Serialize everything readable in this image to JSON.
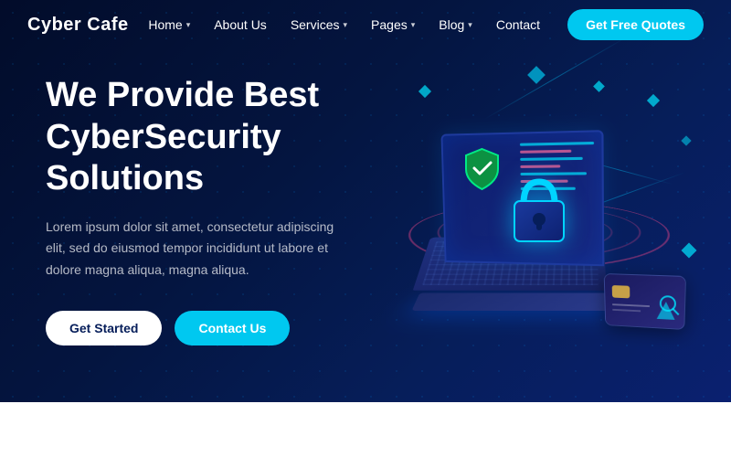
{
  "brand": {
    "name": "Cyber Cafe"
  },
  "nav": {
    "links": [
      {
        "id": "home",
        "label": "Home",
        "hasDropdown": true
      },
      {
        "id": "about",
        "label": "About Us",
        "hasDropdown": false
      },
      {
        "id": "services",
        "label": "Services",
        "hasDropdown": true
      },
      {
        "id": "pages",
        "label": "Pages",
        "hasDropdown": true
      },
      {
        "id": "blog",
        "label": "Blog",
        "hasDropdown": true
      },
      {
        "id": "contact",
        "label": "Contact",
        "hasDropdown": false
      }
    ],
    "cta_label": "Get Free Quotes"
  },
  "hero": {
    "title_line1": "We Provide Best",
    "title_line2": "CyberSecurity Solutions",
    "description": "Lorem ipsum dolor sit amet, consectetur adipiscing elit, sed do eiusmod tempor incididunt ut labore et dolore magna aliqua, magna aliqua.",
    "btn_get_started": "Get Started",
    "btn_contact": "Contact Us"
  }
}
